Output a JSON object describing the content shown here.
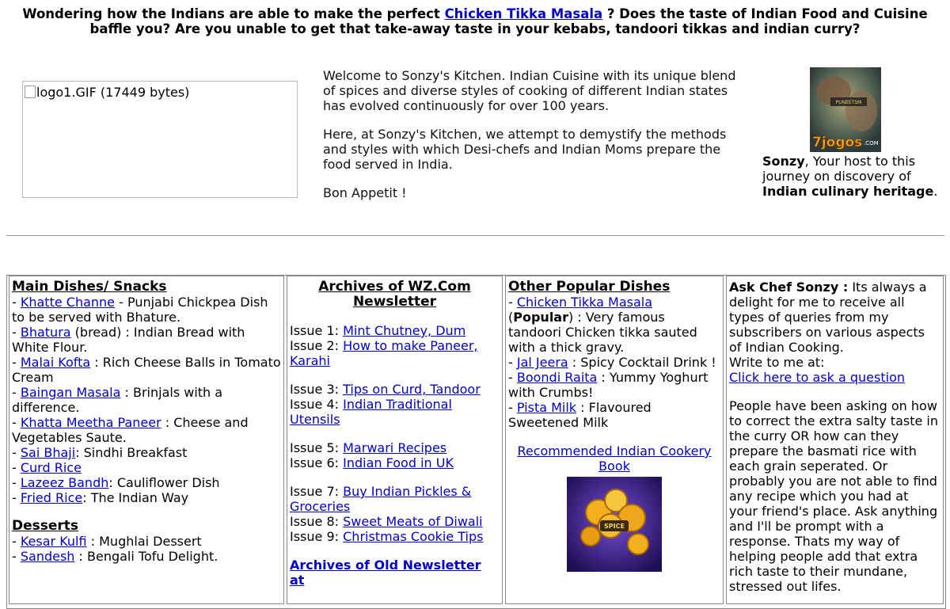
{
  "intro": {
    "before": "Wondering how the Indians are able to make the perfect ",
    "link": "Chicken Tikka Masala",
    "after": " ? Does the taste of Indian Food and Cuisine baffle you? Are you unable to get that take-away taste in your kebabs, tandoori tikkas and indian curry?"
  },
  "logo": {
    "alt": "logo1.GIF (17449 bytes)"
  },
  "welcome": {
    "p1": "Welcome to Sonzy's Kitchen. Indian Cuisine with its unique blend of spices and diverse styles of cooking of different Indian states has evolved continuously for over 100 years.",
    "p2": "Here, at Sonzy's Kitchen, we attempt to demystify the methods and styles with which Desi-chefs and Indian Moms prepare the food served in India.",
    "p3": "Bon Appetit !"
  },
  "host": {
    "img_text_top": "PUNEETSM",
    "img_text_brand": "7jogos",
    "img_text_com": ".COM",
    "name": "Sonzy",
    "middle": ", Your host to this journey on discovery of ",
    "heritage": "Indian culinary heritage",
    "end": "."
  },
  "main_dishes": {
    "header": "Main Dishes/ Snacks",
    "items": [
      {
        "link": "Khatte Channe",
        "desc": " - Punjabi Chickpea Dish to be served with Bhature."
      },
      {
        "link": "Bhatura",
        "desc": " (bread) : Indian Bread with White Flour."
      },
      {
        "link": "Malai Kofta",
        "desc": " : Rich Cheese Balls in Tomato Cream"
      },
      {
        "link": "Baingan Masala",
        "desc": " : Brinjals with a difference."
      },
      {
        "link": "Khatta Meetha Paneer",
        "desc": " : Cheese and Vegetables Saute."
      },
      {
        "link": "Sai Bhaji",
        "desc": ": Sindhi Breakfast"
      },
      {
        "link": "Curd Rice",
        "desc": ""
      },
      {
        "link": "Lazeez Bandh",
        "desc": ": Cauliflower Dish"
      },
      {
        "link": "Fried Rice",
        "desc": ": The Indian Way"
      }
    ],
    "desserts_header": "Desserts",
    "desserts": [
      {
        "link": "Kesar Kulfi",
        "desc": " : Mughlai Dessert"
      },
      {
        "link": "Sandesh",
        "desc": " : Bengali Tofu Delight."
      }
    ]
  },
  "archives": {
    "header": "Archives of WZ.Com Newsletter",
    "groups": [
      [
        {
          "label": "Issue 1: ",
          "link": "Mint Chutney, Dum"
        },
        {
          "label": "Issue 2: ",
          "link": "How to make Paneer, Karahi"
        }
      ],
      [
        {
          "label": "Issue 3: ",
          "link": "Tips on Curd, Tandoor"
        },
        {
          "label": "Issue 4: ",
          "link": "Indian Traditional Utensils"
        }
      ],
      [
        {
          "label": "Issue 5: ",
          "link": "Marwari Recipes"
        },
        {
          "label": "Issue 6: ",
          "link": "Indian Food in UK"
        }
      ],
      [
        {
          "label": "Issue 7: ",
          "link": "Buy Indian Pickles & Groceries"
        },
        {
          "label": "Issue 8: ",
          "link": "Sweet Meats of Diwali"
        },
        {
          "label": "Issue 9: ",
          "link": "Christmas Cookie Tips"
        }
      ]
    ],
    "old_link": "Archives of Old Newsletter at"
  },
  "popular": {
    "header": "Other Popular Dishes",
    "item1_link": "Chicken Tikka Masala",
    "item1_bold": "Popular",
    "item1_desc": ") : Very famous tandoori Chicken tikka sauted with a thick gravy.",
    "item2_link": "Jal Jeera",
    "item2_desc": " : Spicy Cocktail Drink !",
    "item3_link": "Boondi Raita",
    "item3_desc": " : Yummy Yoghurt with Crumbs!",
    "item4_link": "Pista Milk",
    "item4_desc": " : Flavoured Sweetened Milk",
    "book_link": "Recommended Indian Cookery Book",
    "book_img_text": "SPICE"
  },
  "ask": {
    "title": "Ask Chef Sonzy :",
    "intro": " Its always a delight for me to receive all types of queries from my subscribers on various aspects of Indian Cooking.",
    "write": "Write to me at:",
    "link": "Click here to ask a question",
    "para": "People have been asking on how to correct the extra salty taste in the curry OR how can they prepare the basmati rice with each grain seperated. Or probably you are not able to find any recipe which you had at your friend's place. Ask anything and I'll be prompt with a response. Thats my way of helping people add that extra rich taste to their mundane, stressed out lifes."
  }
}
